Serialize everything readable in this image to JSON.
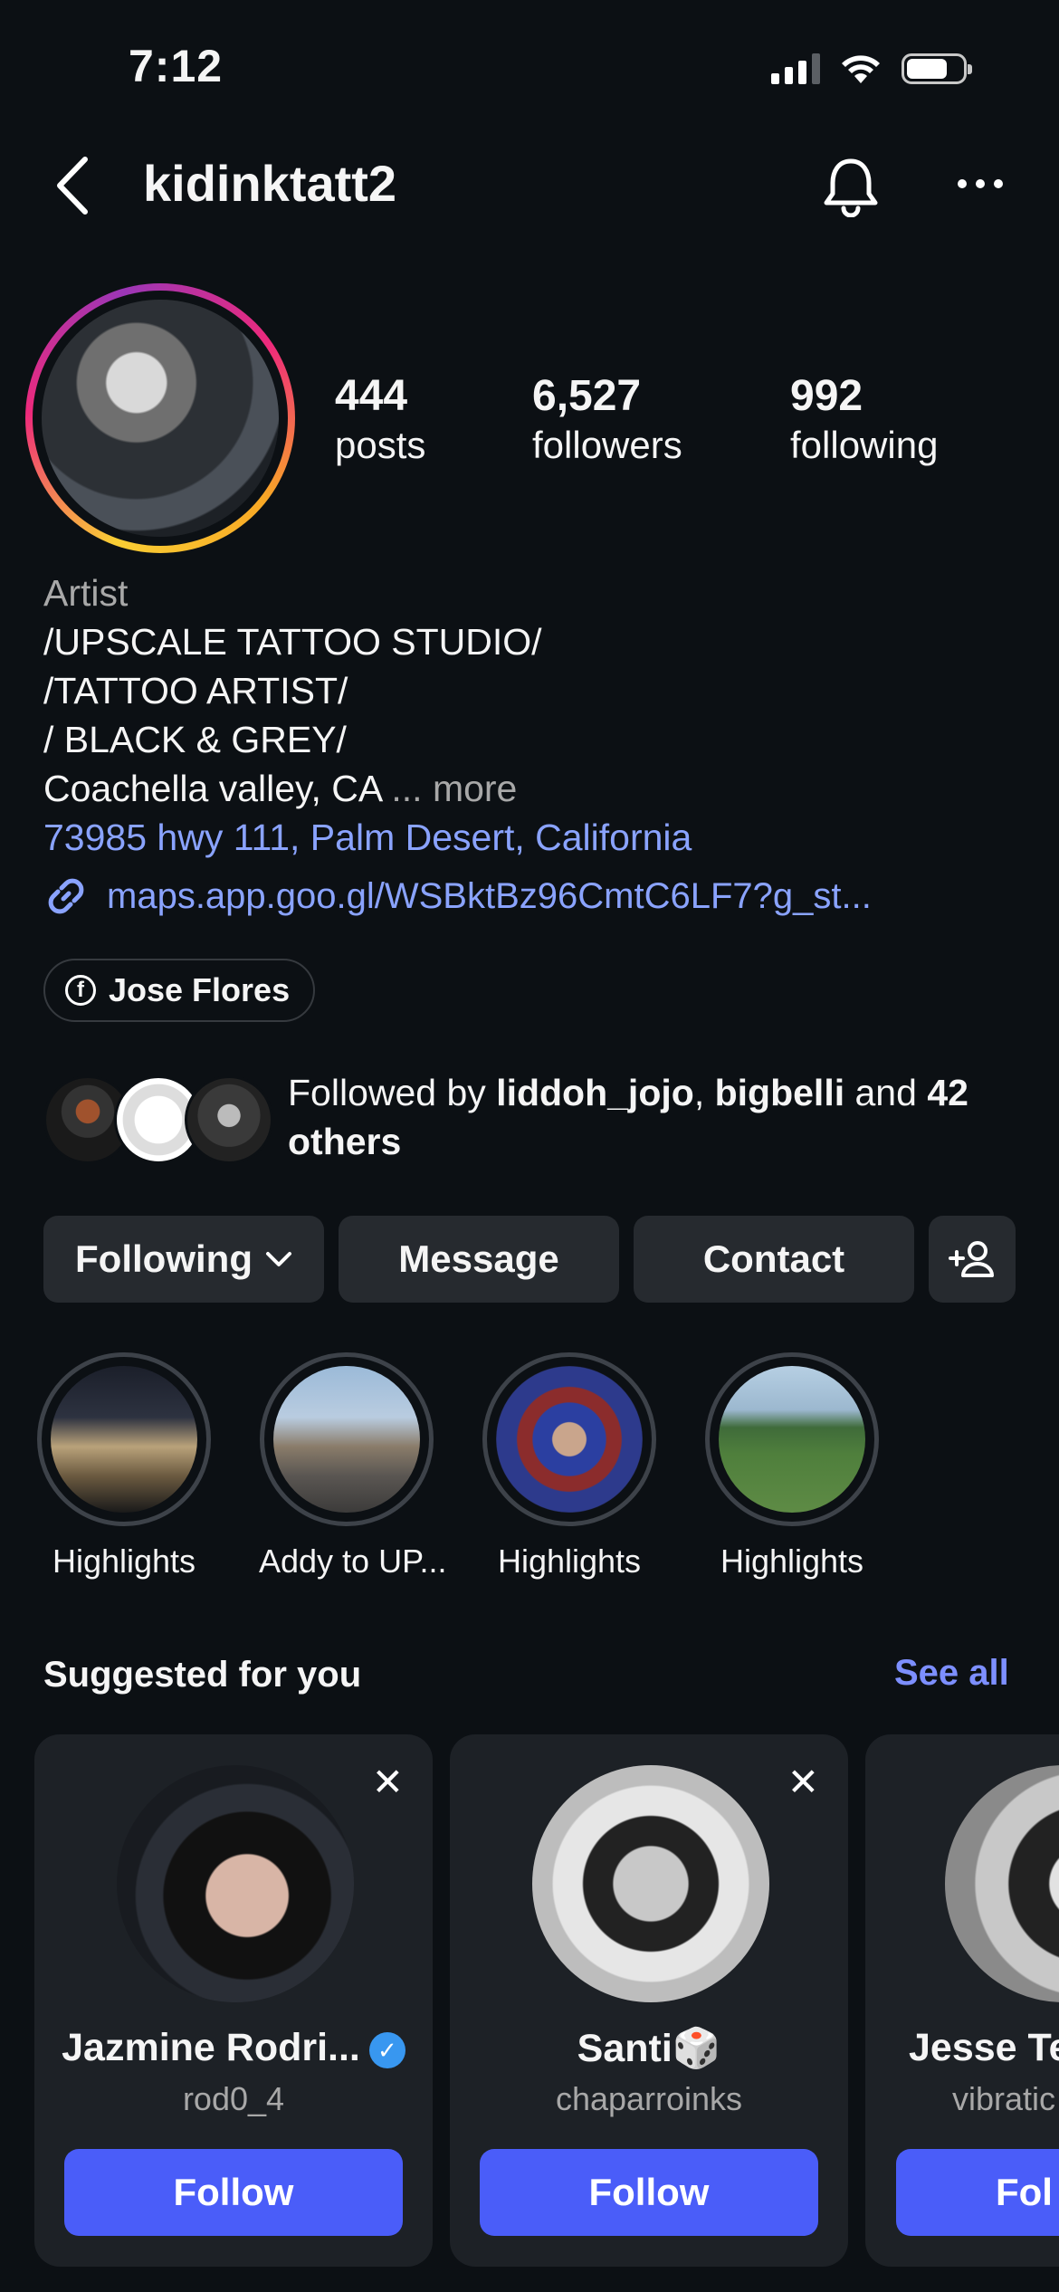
{
  "status_bar": {
    "time": "7:12"
  },
  "header": {
    "username": "kidinktatt2"
  },
  "stats": [
    {
      "value": "444",
      "label": "posts"
    },
    {
      "value": "6,527",
      "label": "followers"
    },
    {
      "value": "992",
      "label": "following"
    }
  ],
  "bio": {
    "category": "Artist",
    "lines": [
      "/UPSCALE TATTOO STUDIO/",
      "/TATTOO ARTIST/",
      "/ BLACK & GREY/"
    ],
    "location": "Coachella valley, CA",
    "more": " ... more",
    "address": "73985 hwy 111, Palm Desert, California",
    "link": "maps.app.goo.gl/WSBktBz96CmtC6LF7?g_st..."
  },
  "facebook_chip": {
    "label": "Jose Flores"
  },
  "followed_by": {
    "prefix": "Followed by ",
    "user1": "liddoh_jojo",
    "sep": ", ",
    "user2": "bigbelli",
    "and": " and ",
    "others": "42 others"
  },
  "actions": {
    "following": "Following",
    "message": "Message",
    "contact": "Contact"
  },
  "highlights": [
    {
      "label": "Highlights"
    },
    {
      "label": "Addy to UP..."
    },
    {
      "label": "Highlights"
    },
    {
      "label": "Highlights"
    }
  ],
  "suggested": {
    "title": "Suggested for you",
    "see_all": "See all",
    "cards": [
      {
        "name": "Jazmine Rodri...",
        "handle": "rod0_4",
        "follow": "Follow",
        "verified": true
      },
      {
        "name": "Santi🎲",
        "handle": "chaparroinks",
        "follow": "Follow"
      },
      {
        "name": "Jesse Te",
        "handle": "vibratic",
        "follow": "Fol"
      }
    ]
  },
  "colors": {
    "background": "#0c1014",
    "link": "#8aa3ff",
    "follow_button": "#4a5df9",
    "card": "#1d2126",
    "button": "#262a2f"
  }
}
